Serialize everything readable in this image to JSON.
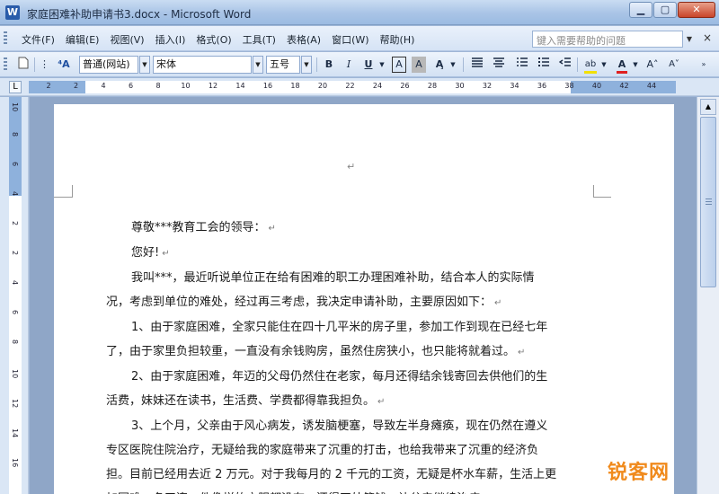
{
  "window": {
    "title": "家庭困难补助申请书3.docx - Microsoft Word",
    "app_icon": "W",
    "controls": {
      "minimize": "▁",
      "maximize": "▢",
      "close": "✕"
    }
  },
  "menu": {
    "items": [
      "文件(F)",
      "编辑(E)",
      "视图(V)",
      "插入(I)",
      "格式(O)",
      "工具(T)",
      "表格(A)",
      "窗口(W)",
      "帮助(H)"
    ],
    "help_placeholder": "键入需要帮助的问题",
    "close_glyph": "×"
  },
  "toolbar": {
    "style_value": "普通(网站)",
    "font_value": "宋体",
    "size_value": "五号",
    "bold": "B",
    "italic": "I",
    "underline": "U",
    "char_border": "A",
    "char_shading": "A",
    "scale": "A̧",
    "highlight": "ab",
    "font_color": "A",
    "grow_font": "A˄",
    "shrink_font": "A˅",
    "accent_highlight": "#f2e000",
    "accent_font_color": "#e02020"
  },
  "ruler": {
    "marks": [
      "2",
      "2",
      "4",
      "6",
      "8",
      "10",
      "12",
      "14",
      "16",
      "18",
      "20",
      "22",
      "24",
      "26",
      "28",
      "30",
      "32",
      "34",
      "36",
      "38",
      "40",
      "42",
      "44"
    ]
  },
  "vruler": {
    "marks": [
      "10",
      "8",
      "6",
      "4",
      "2",
      "2",
      "4",
      "6",
      "8",
      "10",
      "12",
      "14",
      "16"
    ]
  },
  "document": {
    "top_mark": "↵",
    "paragraphs": [
      {
        "text": "尊敬***教育工会的领导：",
        "mark": "↵",
        "indent": true
      },
      {
        "text": "您好!",
        "mark": "↵",
        "indent": true
      },
      {
        "text": "我叫***，最近听说单位正在给有困难的职工办理困难补助，结合本人的实际情",
        "mark": "",
        "indent": true
      },
      {
        "text": "况，考虑到单位的难处，经过再三考虑，我决定申请补助，主要原因如下：",
        "mark": "↵",
        "indent": false
      },
      {
        "text": "1、由于家庭困难，全家只能住在四十几平米的房子里，参加工作到现在已经七年",
        "mark": "",
        "indent": true
      },
      {
        "text": "了，由于家里负担较重，一直没有余钱购房，虽然住房狭小，也只能将就着过。",
        "mark": "↵",
        "indent": false
      },
      {
        "text": "2、由于家庭困难，年迈的父母仍然住在老家，每月还得结余钱寄回去供他们的生",
        "mark": "",
        "indent": true
      },
      {
        "text": "活费，妹妹还在读书，生活费、学费都得靠我担负。",
        "mark": "↵",
        "indent": false
      },
      {
        "text": "3、上个月，父亲由于风心病发，诱发脑梗塞，导致左半身瘫痪，现在仍然在遵义",
        "mark": "",
        "indent": true
      },
      {
        "text": "专区医院住院治疗，无疑给我的家庭带来了沉重的打击，也给我带来了沉重的经济负",
        "mark": "",
        "indent": false
      },
      {
        "text": "担。目前已经用去近 2 万元。对于我每月的 2 千元的工资，无疑是杯水车薪，生活上更",
        "mark": "",
        "indent": false
      },
      {
        "text": "加困难，冬天连一件像样的衣服都没有，还得四处筹钱，让父亲继续治疗。",
        "mark": "↵",
        "indent": false
      }
    ]
  },
  "watermark": "锐客网"
}
